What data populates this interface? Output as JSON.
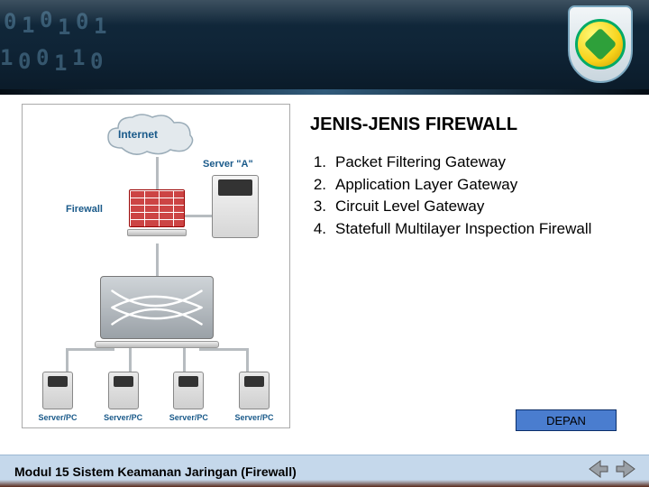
{
  "title": "JENIS-JENIS FIREWALL",
  "list": {
    "items": [
      {
        "num": "1.",
        "text": "Packet Filtering Gateway"
      },
      {
        "num": "2.",
        "text": "Application Layer Gateway"
      },
      {
        "num": "3.",
        "text": "Circuit Level Gateway"
      },
      {
        "num": "4.",
        "text": "Statefull Multilayer Inspection Firewall"
      }
    ]
  },
  "diagram": {
    "internet": "Internet",
    "server_a": "Server \"A\"",
    "firewall": "Firewall",
    "pc_label": "Server/PC"
  },
  "button": {
    "depan": "DEPAN"
  },
  "footer": "Modul 15 Sistem Keamanan Jaringan (Firewall)"
}
